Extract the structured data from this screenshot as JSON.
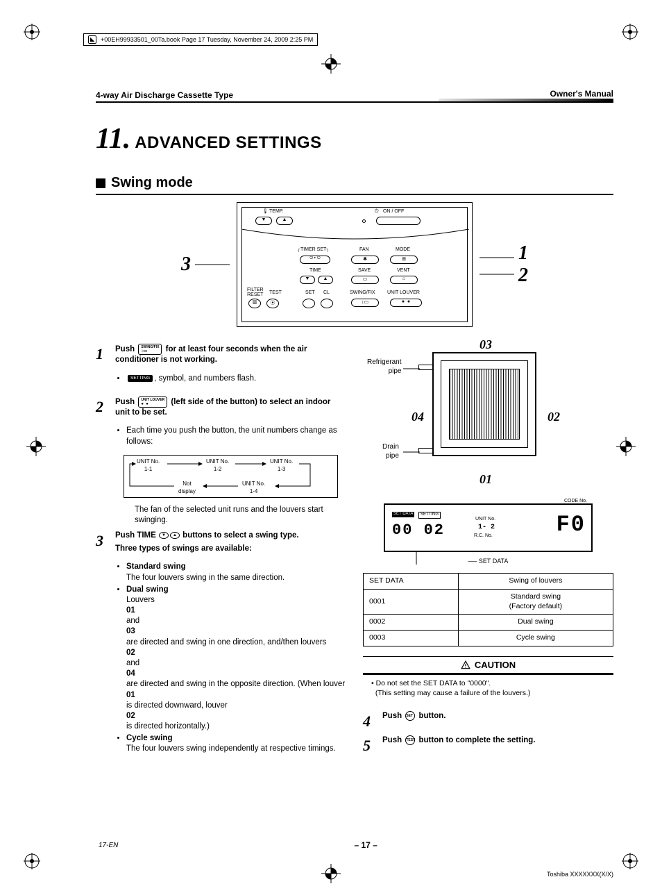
{
  "file_tag": "+00EH99933501_00Ta.book  Page 17  Tuesday, November 24, 2009  2:25 PM",
  "header": {
    "left": "4-way Air Discharge Cassette Type",
    "right": "Owner's Manual"
  },
  "chapter": {
    "number": "11.",
    "title": "ADVANCED SETTINGS"
  },
  "section": {
    "title": "Swing mode"
  },
  "remote": {
    "temp_label": "TEMP.",
    "onoff_label": "ON / OFF",
    "timer_set": "TIMER SET",
    "fan": "FAN",
    "mode": "MODE",
    "time": "TIME",
    "save": "SAVE",
    "vent": "VENT",
    "filter_reset": "FILTER\nRESET",
    "test": "TEST",
    "set": "SET",
    "cl": "CL",
    "swing_fix": "SWING/FIX",
    "unit_louver": "UNIT  LOUVER",
    "callout_left": "3",
    "callout_right_1": "1",
    "callout_right_2": "2"
  },
  "steps": {
    "s1": {
      "num": "1",
      "lead_a": "Push ",
      "btn1": "SWING/FIX",
      "lead_b": " for at least four seconds when the air conditioner is not working.",
      "bullet1_tag": "SETTING",
      "bullet1_rest": ", symbol, and numbers flash."
    },
    "s2": {
      "num": "2",
      "lead_a": "Push ",
      "btn1": "UNIT  LOUVER",
      "lead_b": " (left side of the button) to select an indoor unit to be set.",
      "bullet1": "Each time you push the button, the unit numbers change as follows:",
      "u1": "UNIT No.\n1-1",
      "u2": "UNIT No.\n1-2",
      "u3": "UNIT No.\n1-3",
      "u4": "UNIT No.\n1-4",
      "u_not": "Not\ndisplay",
      "after": "The fan of the selected unit runs and the louvers start swinging."
    },
    "s3": {
      "num": "3",
      "lead_a": "Push TIME ",
      "lead_b": " buttons to select a swing type.",
      "sub_head": "Three types of swings are available:",
      "t1_name": "Standard swing",
      "t1_desc": "The four louvers swing in the same direction.",
      "t2_name": "Dual swing",
      "t2_desc_a": "Louvers ",
      "t2_01": "01",
      "t2_and1": " and ",
      "t2_03": "03",
      "t2_mid": " are directed and swing in one direction, and/then louvers ",
      "t2_02": "02",
      "t2_and2": " and ",
      "t2_04": "04",
      "t2_end": " are directed and swing in the opposite direction. (When louver ",
      "t2_01b": "01",
      "t2_tail1": " is directed downward, louver ",
      "t2_02b": "02",
      "t2_tail2": " is directed horizontally.)",
      "t3_name": "Cycle swing",
      "t3_desc": "The four louvers swing independently at respective timings."
    },
    "s4": {
      "num": "4",
      "lead_a": "Push ",
      "btn": "SET",
      "lead_b": " button."
    },
    "s5": {
      "num": "5",
      "lead_a": "Push ",
      "btn": "TEST",
      "lead_b": " button to complete the setting."
    }
  },
  "cassette": {
    "n01": "01",
    "n02": "02",
    "n03": "03",
    "n04": "04",
    "ref_pipe": "Refrigerant\npipe",
    "drain_pipe": "Drain\npipe"
  },
  "lcd": {
    "setdata_tag": "SET DATA",
    "setting_tag": "SETTING",
    "set_value": "00 02",
    "unit_lbl": "UNIT  No.",
    "unit_val": "1- 2",
    "rc_lbl": "R.C.    No.",
    "code_lbl": "CODE No.",
    "code_val": "F0",
    "pointer_label": "SET DATA"
  },
  "table": {
    "h1": "SET DATA",
    "h2": "Swing of louvers",
    "r1c1": "0001",
    "r1c2": "Standard swing\n(Factory default)",
    "r2c1": "0002",
    "r2c2": "Dual swing",
    "r3c1": "0003",
    "r3c2": "Cycle swing"
  },
  "caution": {
    "title": "CAUTION",
    "line1": "Do not set the SET DATA to \"0000\".",
    "line2": "(This setting may cause a failure of the louvers.)"
  },
  "footer": {
    "left": "17-EN",
    "center": "– 17 –",
    "right": "Toshiba XXXXXXX(X/X)"
  }
}
